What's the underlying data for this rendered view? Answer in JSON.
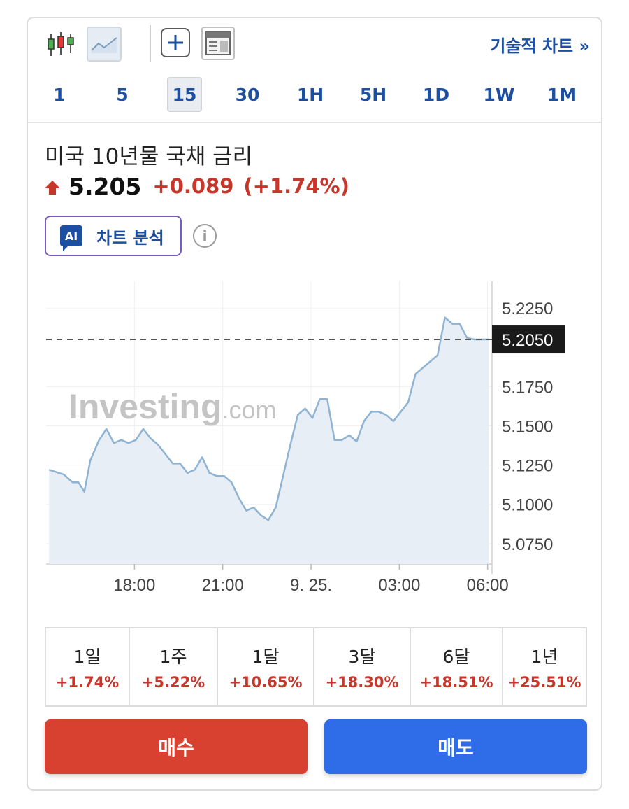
{
  "toolbar": {
    "tech_chart_link": "기술적 차트 »",
    "intervals": [
      "1",
      "5",
      "15",
      "30",
      "1H",
      "5H",
      "1D",
      "1W",
      "1M"
    ],
    "active_interval": "15",
    "icons": [
      "candlestick-icon",
      "area-chart-icon",
      "plus-icon",
      "layout-icon"
    ]
  },
  "instrument": {
    "name": "미국 10년물 국채 금리",
    "price": "5.205",
    "change": "+0.089",
    "change_pct": "(+1.74%)",
    "direction": "up"
  },
  "ai_button": {
    "badge": "AI",
    "label": "차트 분석"
  },
  "info_icon": "i",
  "chart_data": {
    "type": "area",
    "watermark": "Investing.com",
    "x_tick_labels": [
      "18:00",
      "21:00",
      "9. 25.",
      "03:00",
      "06:00"
    ],
    "y_tick_labels": [
      "5.2250",
      "5.1750",
      "5.1500",
      "5.1250",
      "5.1000",
      "5.0750"
    ],
    "current_value_label": "5.2050",
    "current_value": 5.205,
    "ylim": [
      5.062,
      5.242
    ],
    "xlim": [
      15.0,
      30.15
    ],
    "series": [
      {
        "x": [
          15.1,
          15.6,
          15.9,
          16.1,
          16.3,
          16.5,
          16.8,
          17.05,
          17.3,
          17.55,
          17.8,
          18.05,
          18.3,
          18.55,
          18.8,
          19.05,
          19.3,
          19.55,
          19.8,
          20.05,
          20.3,
          20.55,
          20.8,
          21.05,
          21.3,
          21.55,
          21.8,
          22.05,
          22.3,
          22.55,
          22.8,
          23.05,
          23.3,
          23.55,
          23.8,
          24.05,
          24.3,
          24.55,
          24.8,
          25.05,
          25.3,
          25.55,
          25.8,
          26.05,
          26.3,
          26.55,
          26.8,
          27.05,
          27.3,
          27.55,
          27.8,
          28.05,
          28.3,
          28.55,
          28.8,
          29.05,
          29.3,
          29.55,
          29.8,
          30.05
        ],
        "values": [
          5.122,
          5.119,
          5.114,
          5.114,
          5.108,
          5.128,
          5.141,
          5.148,
          5.139,
          5.141,
          5.139,
          5.141,
          5.148,
          5.142,
          5.138,
          5.132,
          5.126,
          5.126,
          5.12,
          5.122,
          5.13,
          5.12,
          5.118,
          5.118,
          5.114,
          5.104,
          5.096,
          5.098,
          5.093,
          5.09,
          5.098,
          5.118,
          5.138,
          5.157,
          5.161,
          5.155,
          5.167,
          5.167,
          5.141,
          5.141,
          5.144,
          5.14,
          5.153,
          5.159,
          5.159,
          5.157,
          5.153,
          5.159,
          5.165,
          5.183,
          5.187,
          5.191,
          5.195,
          5.219,
          5.215,
          5.215,
          5.206,
          5.205,
          5.205,
          5.205
        ]
      }
    ],
    "colors": {
      "line": "#8fb3d3",
      "fill": "#e8eef5",
      "price_tag": "#1a1a1a"
    }
  },
  "performance": [
    {
      "period": "1일",
      "value": "+1.74%"
    },
    {
      "period": "1주",
      "value": "+5.22%"
    },
    {
      "period": "1달",
      "value": "+10.65%"
    },
    {
      "period": "3달",
      "value": "+18.30%"
    },
    {
      "period": "6달",
      "value": "+18.51%"
    },
    {
      "period": "1년",
      "value": "+25.51%"
    }
  ],
  "actions": {
    "buy_label": "매수",
    "sell_label": "매도"
  },
  "colors": {
    "accent": "#1d4fa0",
    "up": "#c7362a",
    "buy": "#d8402f",
    "sell": "#2f6de8"
  }
}
